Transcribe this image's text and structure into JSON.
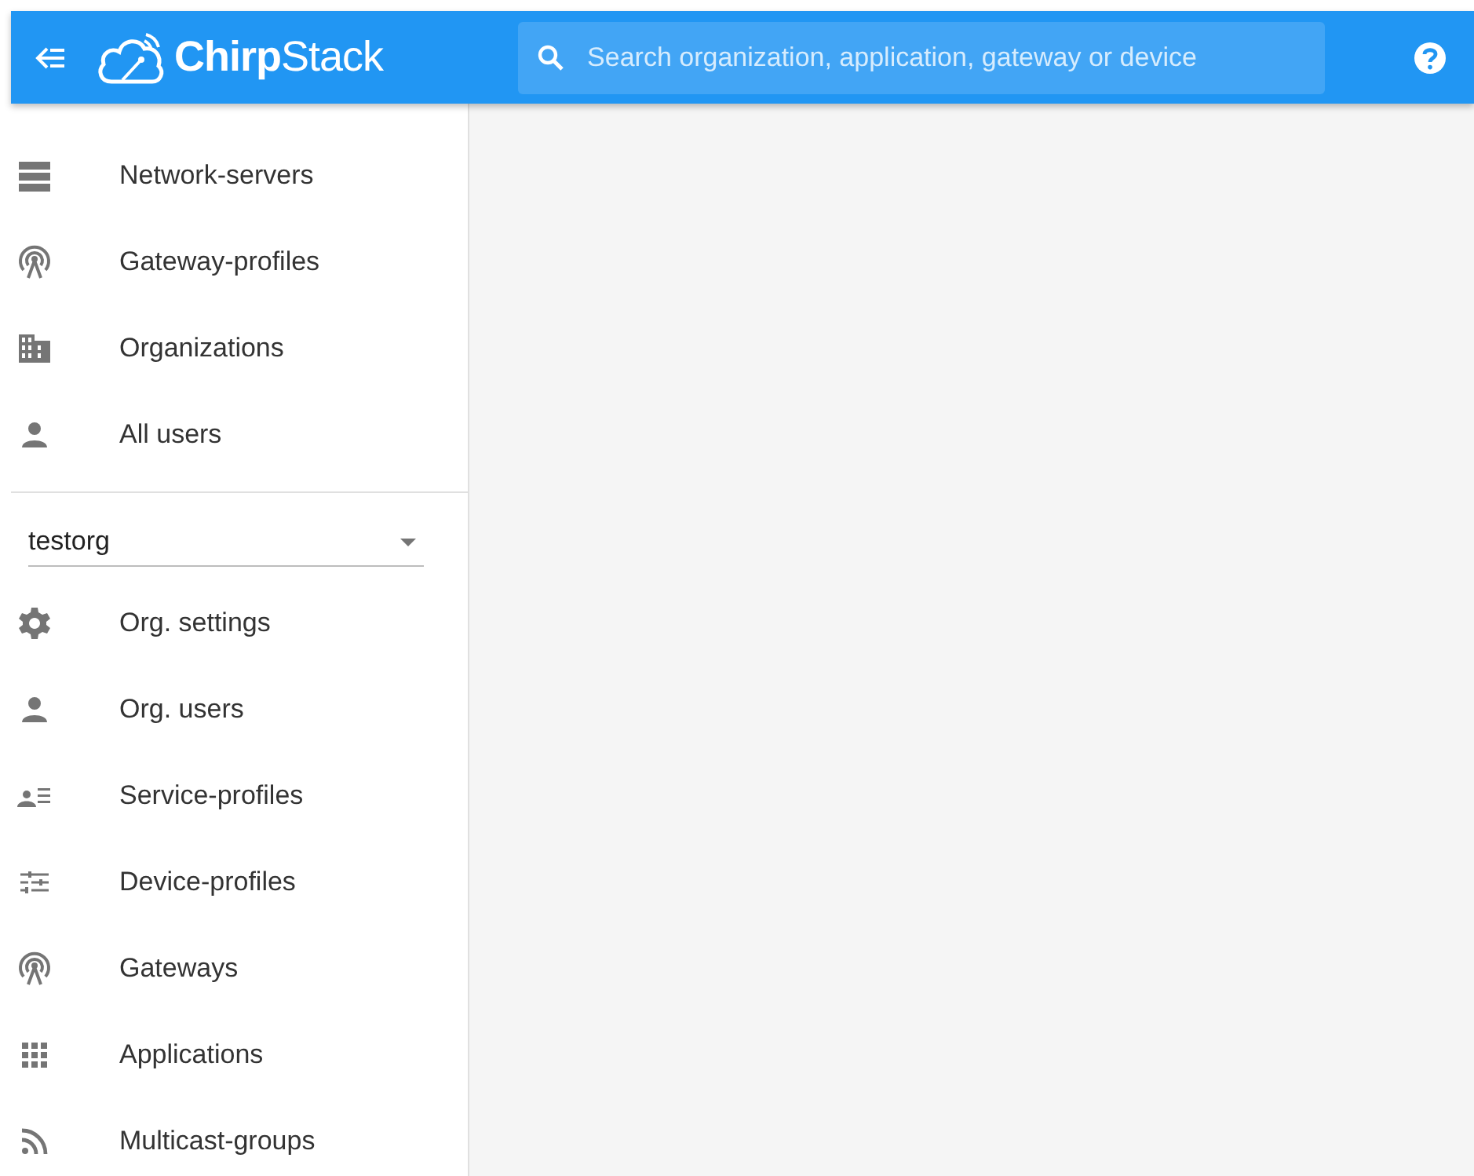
{
  "header": {
    "logo": "**Chirp**Stack",
    "search": {
      "placeholder": "Search organization, application, gateway or device"
    }
  },
  "sidebar": {
    "items": [
      {
        "kind": "servers",
        "label": "Network-servers"
      },
      {
        "kind": "antenna",
        "label": "Gateway-profiles"
      },
      {
        "kind": "building",
        "label": "Organizations"
      },
      {
        "kind": "person",
        "label": "All users"
      }
    ],
    "organization_select": {
      "value": "testorg"
    },
    "org_items": [
      {
        "kind": "gear",
        "label": "Org. settings"
      },
      {
        "kind": "person",
        "label": "Org. users"
      },
      {
        "kind": "person-list",
        "label": "Service-profiles"
      },
      {
        "kind": "sliders",
        "label": "Device-profiles"
      },
      {
        "kind": "antenna",
        "label": "Gateways"
      },
      {
        "kind": "grid",
        "label": "Applications"
      },
      {
        "kind": "feed",
        "label": "Multicast-groups"
      }
    ]
  }
}
